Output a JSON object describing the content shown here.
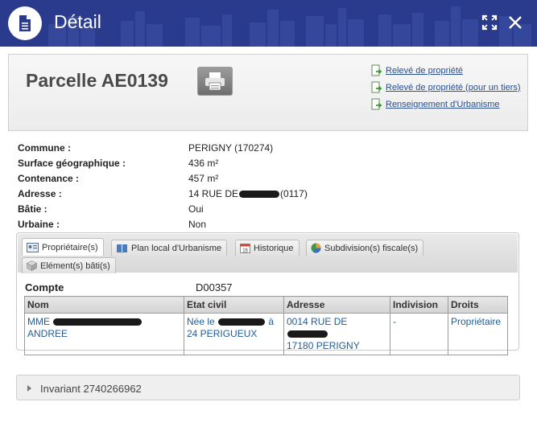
{
  "header": {
    "title": "Détail"
  },
  "parcel": {
    "title": "Parcelle AE0139",
    "links": [
      "Relevé de propriété",
      "Relevé de propriété (pour un tiers)",
      "Renseignement d'Urbanisme"
    ]
  },
  "info": {
    "commune_label": "Commune :",
    "commune_value": "PERIGNY (170274)",
    "surface_label": "Surface géographique :",
    "surface_value": "436 m²",
    "contenance_label": "Contenance :",
    "contenance_value": "457 m²",
    "adresse_label": "Adresse :",
    "adresse_prefix": "14 RUE DE",
    "adresse_suffix": "(0117)",
    "batie_label": "Bâtie :",
    "batie_value": "Oui",
    "urbaine_label": "Urbaine :",
    "urbaine_value": "Non"
  },
  "tabs": [
    "Propriétaire(s)",
    "Plan local d'Urbanisme",
    "Historique",
    "Subdivision(s) fiscale(s)",
    "Elément(s) bâti(s)"
  ],
  "owners": {
    "compte_label": "Compte",
    "compte_value": "D00357",
    "columns": [
      "Nom",
      "Etat civil",
      "Adresse",
      "Indivision",
      "Droits"
    ],
    "row": {
      "nom_prefix": "MME",
      "nom_suffix": "ANDREE",
      "etat_line1_prefix": "Née le",
      "etat_line1_suffix": "à",
      "etat_line2": "24 PERIGUEUX",
      "adresse_line1_prefix": "0014 RUE DE",
      "adresse_line2": "17180 PERIGNY",
      "indivision": "-",
      "droits": "Propriétaire"
    }
  },
  "invariant": {
    "label": "Invariant 2740266962"
  },
  "colors": {
    "header_bg": "#2a3a8c",
    "link": "#2b4f8c",
    "table_text": "#1e5d9b"
  }
}
